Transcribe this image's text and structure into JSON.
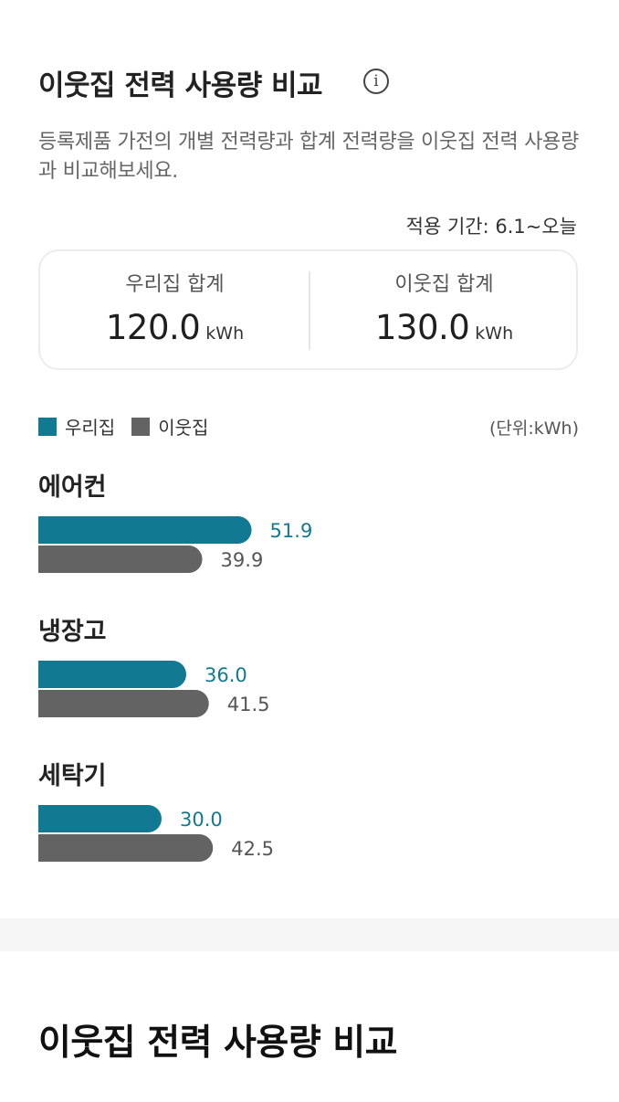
{
  "title": "이웃집 전력 사용량 비교",
  "info_icon": "info-icon",
  "description": "등록제품 가전의 개별 전력량과 합계 전력량을 이웃집 전력 사용량과 비교해보세요.",
  "period": "적용 기간: 6.1~오늘",
  "summary": {
    "ours": {
      "label": "우리집 합계",
      "value": "120.0",
      "unit": "kWh"
    },
    "neighbor": {
      "label": "이웃집 합계",
      "value": "130.0",
      "unit": "kWh"
    }
  },
  "legend": {
    "ours": "우리집",
    "neighbor": "이웃집"
  },
  "unit_note": "(단위:kWh)",
  "colors": {
    "ours": "#117a92",
    "neighbor": "#636363"
  },
  "chart_data": {
    "type": "bar",
    "orientation": "horizontal",
    "categories": [
      "에어컨",
      "냉장고",
      "세탁기"
    ],
    "series": [
      {
        "name": "우리집",
        "values": [
          51.9,
          36.0,
          30.0
        ]
      },
      {
        "name": "이웃집",
        "values": [
          39.9,
          41.5,
          42.5
        ]
      }
    ],
    "unit": "kWh"
  },
  "bottom_title": "이웃집 전력 사용량 비교"
}
